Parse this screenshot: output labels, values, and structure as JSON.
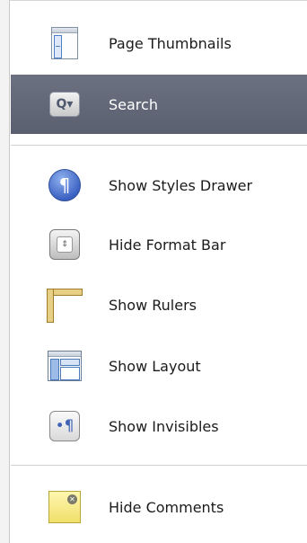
{
  "menu": {
    "items": [
      {
        "label": "Page Thumbnails",
        "icon": "page-thumbnails-icon",
        "selected": false
      },
      {
        "label": "Search",
        "icon": "search-icon",
        "selected": true
      },
      {
        "label": "Show Styles Drawer",
        "icon": "styles-drawer-icon",
        "selected": false
      },
      {
        "label": "Hide Format Bar",
        "icon": "format-bar-icon",
        "selected": false
      },
      {
        "label": "Show Rulers",
        "icon": "rulers-icon",
        "selected": false
      },
      {
        "label": "Show Layout",
        "icon": "layout-icon",
        "selected": false
      },
      {
        "label": "Show Invisibles",
        "icon": "invisibles-icon",
        "selected": false
      },
      {
        "label": "Hide Comments",
        "icon": "comments-icon",
        "selected": false
      }
    ],
    "selected_color": "#5f6576"
  }
}
